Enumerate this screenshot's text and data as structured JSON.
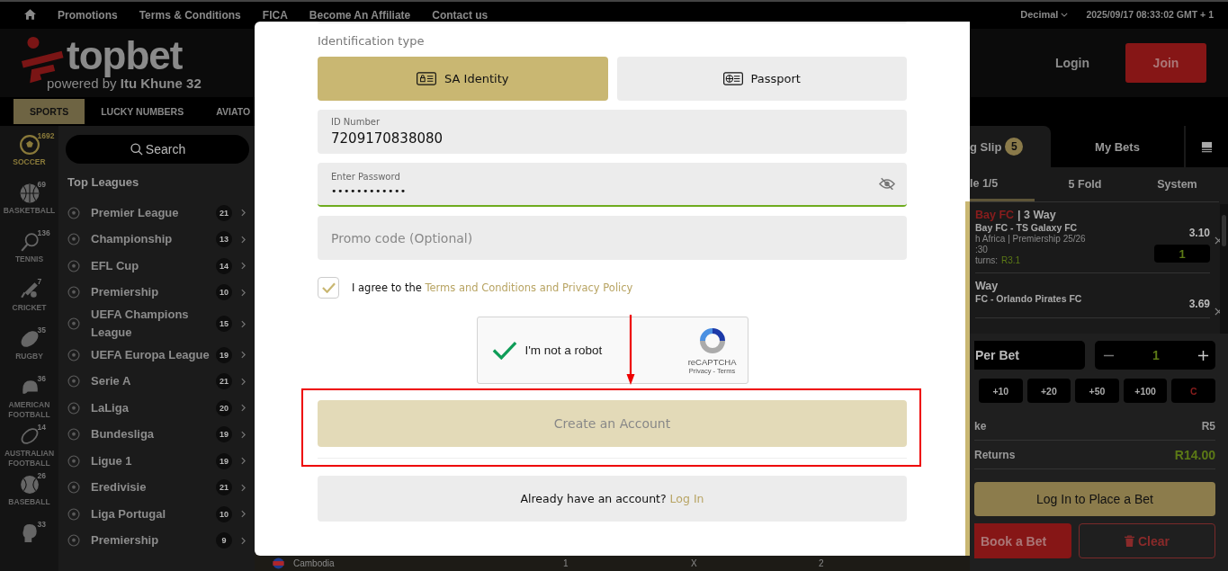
{
  "top_nav": {
    "links": [
      {
        "label": "Promotions"
      },
      {
        "label": "Terms & Conditions"
      },
      {
        "label": "FICA"
      },
      {
        "label": "Become An Affiliate"
      },
      {
        "label": "Contact us"
      }
    ],
    "odds_format": "Decimal",
    "datetime": "2025/09/17  08:33:02 GMT + 1"
  },
  "header": {
    "logo": "topbet",
    "tagline": "powered by **Itu Khune 32**",
    "login": "Login",
    "join": "Join"
  },
  "tabs": [
    {
      "label": "SPORTS",
      "selected": true
    },
    {
      "label": "LUCKY NUMBERS",
      "selected": false
    },
    {
      "label": "AVIATO",
      "selected": false
    }
  ],
  "sports": [
    {
      "kind": "soccer",
      "label": "SOCCER",
      "count": "1692",
      "selected": true
    },
    {
      "kind": "basketball",
      "label": "BASKETBALL",
      "count": "69",
      "selected": false
    },
    {
      "kind": "tennis",
      "label": "TENNIS",
      "count": "136",
      "selected": false
    },
    {
      "kind": "cricket",
      "label": "CRICKET",
      "count": "7",
      "selected": false
    },
    {
      "kind": "rugby",
      "label": "RUGBY",
      "count": "35",
      "selected": false
    },
    {
      "kind": "american-football",
      "label": "AMERICAN FOOTBALL",
      "count": "36",
      "selected": false
    },
    {
      "kind": "australian-football",
      "label": "AUSTRALIAN FOOTBALL",
      "count": "14",
      "selected": false
    },
    {
      "kind": "baseball",
      "label": "BASEBALL",
      "count": "26",
      "selected": false
    },
    {
      "kind": "boxing",
      "count": "33",
      "selected": false
    }
  ],
  "search": {
    "placeholder": "Search"
  },
  "leagues": {
    "title": "Top Leagues",
    "items": [
      {
        "name": "Premier League",
        "count": "21"
      },
      {
        "name": "Championship",
        "count": "13"
      },
      {
        "name": "EFL Cup",
        "count": "14"
      },
      {
        "name": "Premiership",
        "count": "10"
      },
      {
        "name": "UEFA Champions League",
        "count": "15"
      },
      {
        "name": "UEFA Europa League",
        "count": "19"
      },
      {
        "name": "Serie A",
        "count": "21"
      },
      {
        "name": "LaLiga",
        "count": "20"
      },
      {
        "name": "Bundesliga",
        "count": "19"
      },
      {
        "name": "Ligue 1",
        "count": "19"
      },
      {
        "name": "Eredivisie",
        "count": "21"
      },
      {
        "name": "Liga Portugal",
        "count": "10"
      },
      {
        "name": "Premiership",
        "count": "9"
      }
    ]
  },
  "match": {
    "country": "Cambodia",
    "odds": [
      "1",
      "X",
      "2"
    ]
  },
  "registration": {
    "id_type_label": "Identification type",
    "id_types": [
      {
        "kind": "id-card",
        "label": "SA Identity",
        "selected": true
      },
      {
        "kind": "passport",
        "label": "Passport",
        "selected": false
      }
    ],
    "fields": [
      {
        "kind": "text",
        "label": "ID Number",
        "value": "7209170838080",
        "focused": false
      },
      {
        "kind": "password",
        "label": "Enter Password",
        "value": "••••••••••••",
        "focused": true
      },
      {
        "kind": "text",
        "placeholder": "Promo code (Optional)",
        "focused": false
      }
    ],
    "agree": {
      "checked": true,
      "text": "I agree to the",
      "link": "Terms and Conditions and Privacy Policy"
    },
    "captcha": {
      "checked": true,
      "label": "I'm not a robot",
      "brand": "reCAPTCHA",
      "links": "Privacy - Terms"
    },
    "submit": {
      "label": "Create an Account",
      "disabled": true
    },
    "login_prompt": {
      "text": "Already have an account?",
      "link": "Log In"
    }
  },
  "bet_slip": {
    "tabs": [
      {
        "label": "g Slip",
        "badge": "5",
        "selected": true
      },
      {
        "label": "My Bets",
        "selected": false
      }
    ],
    "bet_types": [
      {
        "label": "le 1/5",
        "selected": true
      },
      {
        "label": "5 Fold",
        "selected": false
      },
      {
        "label": "System",
        "selected": false
      }
    ],
    "bets": [
      {
        "team": "Bay FC",
        "market": "| 3 Way",
        "match": "Bay FC - TS Galaxy FC",
        "competition": "h Africa | Premiership 25/26",
        "time": ":30",
        "returns_label": "turns:",
        "returns": "R3.1",
        "odds": "3.10",
        "stake": "1"
      },
      {
        "market": "Way",
        "match": "FC - Orlando Pirates FC",
        "odds": "3.69"
      }
    ],
    "stake_label": "Per Bet",
    "stake": "1",
    "quick_stakes": [
      "+10",
      "+20",
      "+50",
      "+100"
    ],
    "clear_key": "C",
    "total_stake_label": "ke",
    "total_stake": "R5",
    "returns_label": "Returns",
    "returns": "R14.00",
    "place_button": "Log In to Place a Bet",
    "book_button": "Book a Bet",
    "clear_button": "Clear"
  },
  "annotations": [
    {
      "kind": "box"
    },
    {
      "kind": "arrow"
    }
  ]
}
